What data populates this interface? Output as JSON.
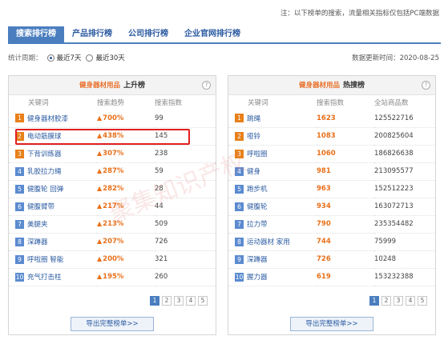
{
  "note": "注：以下榜单的搜索，流量相关指标仅包括PC端数据",
  "tabs": [
    "搜索排行榜",
    "产品排行榜",
    "公司排行榜",
    "企业官网排行榜"
  ],
  "period": {
    "label": "统计周期：",
    "options": [
      "最近7天",
      "最近30天"
    ],
    "selected": 0
  },
  "updated": "数据更新时间：2020-08-25",
  "left": {
    "category": "健身器材用品",
    "kind": "上升榜",
    "headers": [
      "关键词",
      "搜索趋势",
      "搜索指数"
    ],
    "rows": [
      {
        "rank": "1",
        "keyword": "健身器材胶漆",
        "trend": "700%",
        "index": "99"
      },
      {
        "rank": "2",
        "keyword": "电动筋膜球",
        "trend": "438%",
        "index": "145"
      },
      {
        "rank": "3",
        "keyword": "下背训练器",
        "trend": "307%",
        "index": "238"
      },
      {
        "rank": "4",
        "keyword": "乳胶拉力绳",
        "trend": "287%",
        "index": "59"
      },
      {
        "rank": "5",
        "keyword": "健腹轮 回弹",
        "trend": "282%",
        "index": "28"
      },
      {
        "rank": "6",
        "keyword": "健腹臂带",
        "trend": "217%",
        "index": "44"
      },
      {
        "rank": "7",
        "keyword": "美腿夹",
        "trend": "213%",
        "index": "509"
      },
      {
        "rank": "8",
        "keyword": "深蹲器",
        "trend": "207%",
        "index": "726"
      },
      {
        "rank": "9",
        "keyword": "呼啦圈 智能",
        "trend": "200%",
        "index": "321"
      },
      {
        "rank": "10",
        "keyword": "充气打击柱",
        "trend": "195%",
        "index": "260"
      }
    ],
    "pages": [
      "1",
      "2",
      "3",
      "4",
      "5"
    ],
    "export": "导出完整榜单>>"
  },
  "right": {
    "category": "健身器材用品",
    "kind": "热搜榜",
    "headers": [
      "关键词",
      "搜索指数",
      "全站商品数"
    ],
    "rows": [
      {
        "rank": "1",
        "keyword": "跳绳",
        "index": "1623",
        "count": "125522716"
      },
      {
        "rank": "2",
        "keyword": "哑铃",
        "index": "1083",
        "count": "200825604"
      },
      {
        "rank": "3",
        "keyword": "呼啦圈",
        "index": "1060",
        "count": "186826638"
      },
      {
        "rank": "4",
        "keyword": "健身",
        "index": "981",
        "count": "213095577"
      },
      {
        "rank": "5",
        "keyword": "跑步机",
        "index": "963",
        "count": "152512223"
      },
      {
        "rank": "6",
        "keyword": "健腹轮",
        "index": "934",
        "count": "163072713"
      },
      {
        "rank": "7",
        "keyword": "拉力带",
        "index": "790",
        "count": "235354482"
      },
      {
        "rank": "8",
        "keyword": "运动器材 家用",
        "index": "744",
        "count": "75999"
      },
      {
        "rank": "9",
        "keyword": "深蹲器",
        "index": "726",
        "count": "10248"
      },
      {
        "rank": "10",
        "keyword": "握力器",
        "index": "619",
        "count": "153232388"
      }
    ],
    "pages": [
      "1",
      "2",
      "3",
      "4",
      "5"
    ],
    "export": "导出完整榜单>>"
  },
  "watermark": "聚集知识产权",
  "colors": {
    "tab_active": "#4a7ebf",
    "accent_orange": "#e8701a",
    "rank_top": "#e8801a",
    "rank_rest": "#5b8bd0",
    "highlight": "#e02020"
  }
}
